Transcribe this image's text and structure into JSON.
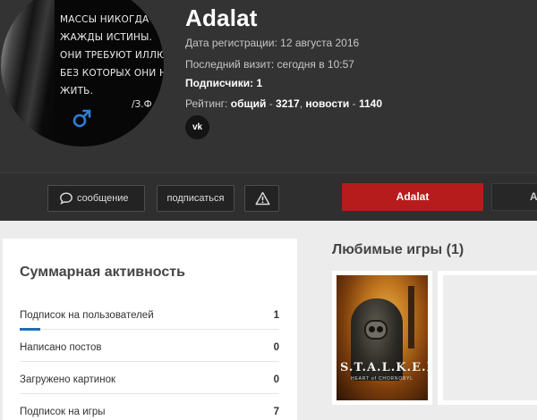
{
  "profile": {
    "name": "Adalat",
    "registration_label": "Дата регистрации:",
    "registration_value": "12 августа 2016",
    "last_visit_label": "Последний визит:",
    "last_visit_value": "сегодня в 10:57",
    "subscribers_label": "Подписчики:",
    "subscribers_value": "1",
    "rating_label": "Рейтинг:",
    "rating_total_label": "общий",
    "rating_total_value": "3217",
    "rating_news_label": "новости",
    "rating_news_value": "1140",
    "vk_label": "vk",
    "gender_icon": "male-symbol-icon",
    "avatar_quote": "МАССЫ НИКОГДА\nЖАЖДЫ ИСТИНЫ.\nОНИ ТРЕБУЮТ ИЛЛЮЗ\nБЕЗ КОТОРЫХ ОНИ НЕ\nЖИТЬ.",
    "avatar_author": "/З.Ф"
  },
  "actions": {
    "message_label": "сообщение",
    "subscribe_label": "подписаться",
    "report_icon": "warning-triangle-icon"
  },
  "tabs": {
    "active_label": "Adalat",
    "next_label": "А"
  },
  "activity": {
    "title": "Суммарная активность",
    "rows": [
      {
        "label": "Подписок на пользователей",
        "value": "1",
        "fill": 0.08
      },
      {
        "label": "Написано постов",
        "value": "0",
        "fill": 0
      },
      {
        "label": "Загружено картинок",
        "value": "0",
        "fill": 0
      },
      {
        "label": "Подписок на игры",
        "value": "7",
        "fill": 0
      }
    ]
  },
  "games": {
    "title": "Любимые игры (1)",
    "items": [
      {
        "logo": "S.T.A.L.K.E.R.2",
        "subtitle": "HEART of CHORNOBYL"
      }
    ]
  },
  "colors": {
    "header_bg": "#333333",
    "accent_red": "#b71c1c",
    "progress_blue": "#1d6fb8",
    "gender_blue": "#2d7fd3"
  }
}
